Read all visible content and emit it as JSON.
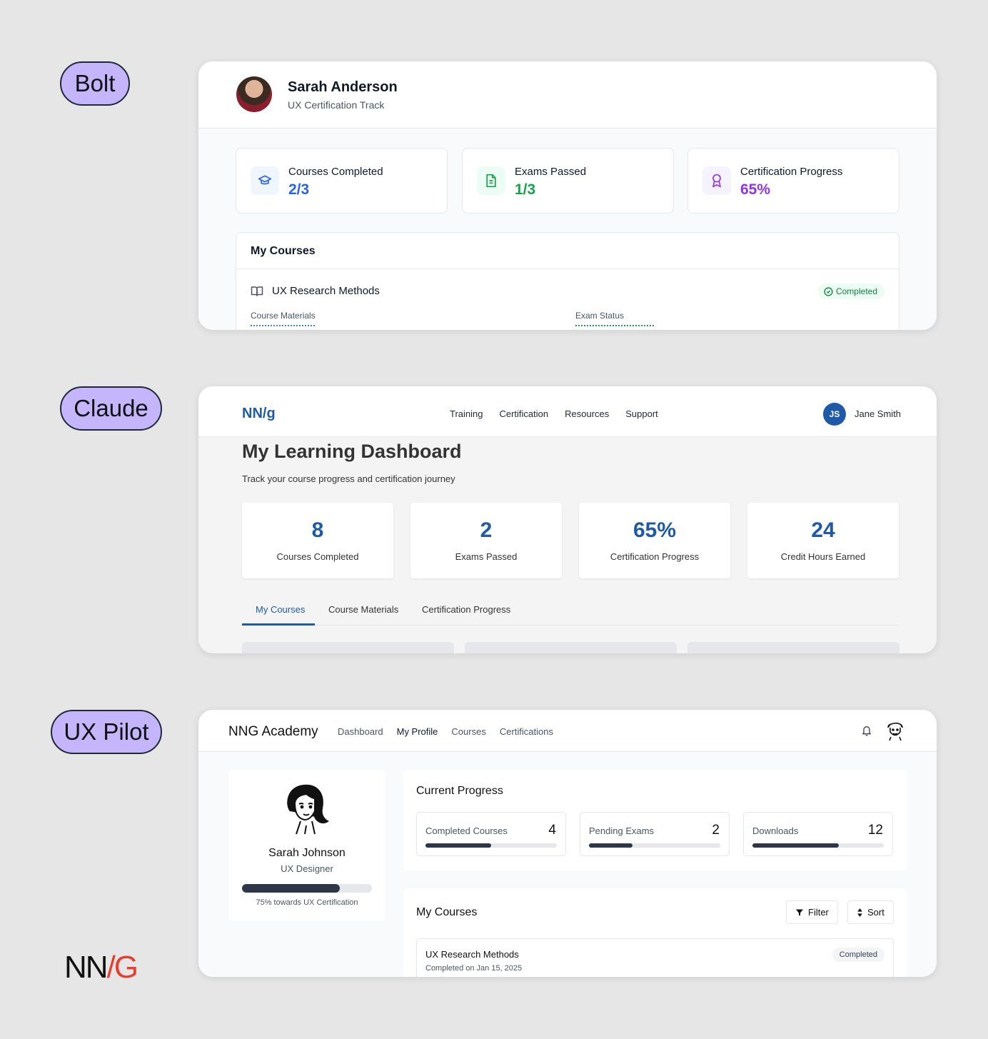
{
  "labels": {
    "bolt": "Bolt",
    "claude": "Claude",
    "uxpilot": "UX Pilot"
  },
  "nng_logo": {
    "left": "NN",
    "slash": "/",
    "right": "G"
  },
  "bolt": {
    "user_name": "Sarah Anderson",
    "track": "UX Certification Track",
    "stats": [
      {
        "label": "Courses Completed",
        "value": "2/3",
        "color": "#2563eb",
        "icon": "graduation-cap-icon"
      },
      {
        "label": "Exams Passed",
        "value": "1/3",
        "color": "#16a34a",
        "icon": "document-icon"
      },
      {
        "label": "Certification Progress",
        "value": "65%",
        "color": "#9333ea",
        "icon": "award-icon"
      }
    ],
    "courses_title": "My Courses",
    "course": {
      "name": "UX Research Methods",
      "status": "Completed",
      "materials_label": "Course Materials",
      "exam_label": "Exam Status"
    }
  },
  "claude": {
    "logo": "NN/g",
    "nav": [
      "Training",
      "Certification",
      "Resources",
      "Support"
    ],
    "avatar_initials": "JS",
    "user_name": "Jane Smith",
    "title": "My Learning Dashboard",
    "subtitle": "Track your course progress and certification journey",
    "stats": [
      {
        "value": "8",
        "label": "Courses Completed"
      },
      {
        "value": "2",
        "label": "Exams Passed"
      },
      {
        "value": "65%",
        "label": "Certification Progress"
      },
      {
        "value": "24",
        "label": "Credit Hours Earned"
      }
    ],
    "tabs": [
      "My Courses",
      "Course Materials",
      "Certification Progress"
    ],
    "active_tab": "My Courses"
  },
  "uxpilot": {
    "brand": "NNG Academy",
    "nav": [
      "Dashboard",
      "My Profile",
      "Courses",
      "Certifications"
    ],
    "current_nav": "My Profile",
    "profile": {
      "name": "Sarah Johnson",
      "role": "UX Designer",
      "progress": 0.75,
      "note": "75% towards UX Certification"
    },
    "progress_title": "Current Progress",
    "stats": [
      {
        "label": "Completed Courses",
        "value": "4",
        "progress": 0.5
      },
      {
        "label": "Pending Exams",
        "value": "2",
        "progress": 0.33
      },
      {
        "label": "Downloads",
        "value": "12",
        "progress": 0.66
      }
    ],
    "courses_title": "My Courses",
    "filter_label": "Filter",
    "sort_label": "Sort",
    "course": {
      "name": "UX Research Methods",
      "date": "Completed on Jan 15, 2025",
      "status": "Completed"
    }
  }
}
